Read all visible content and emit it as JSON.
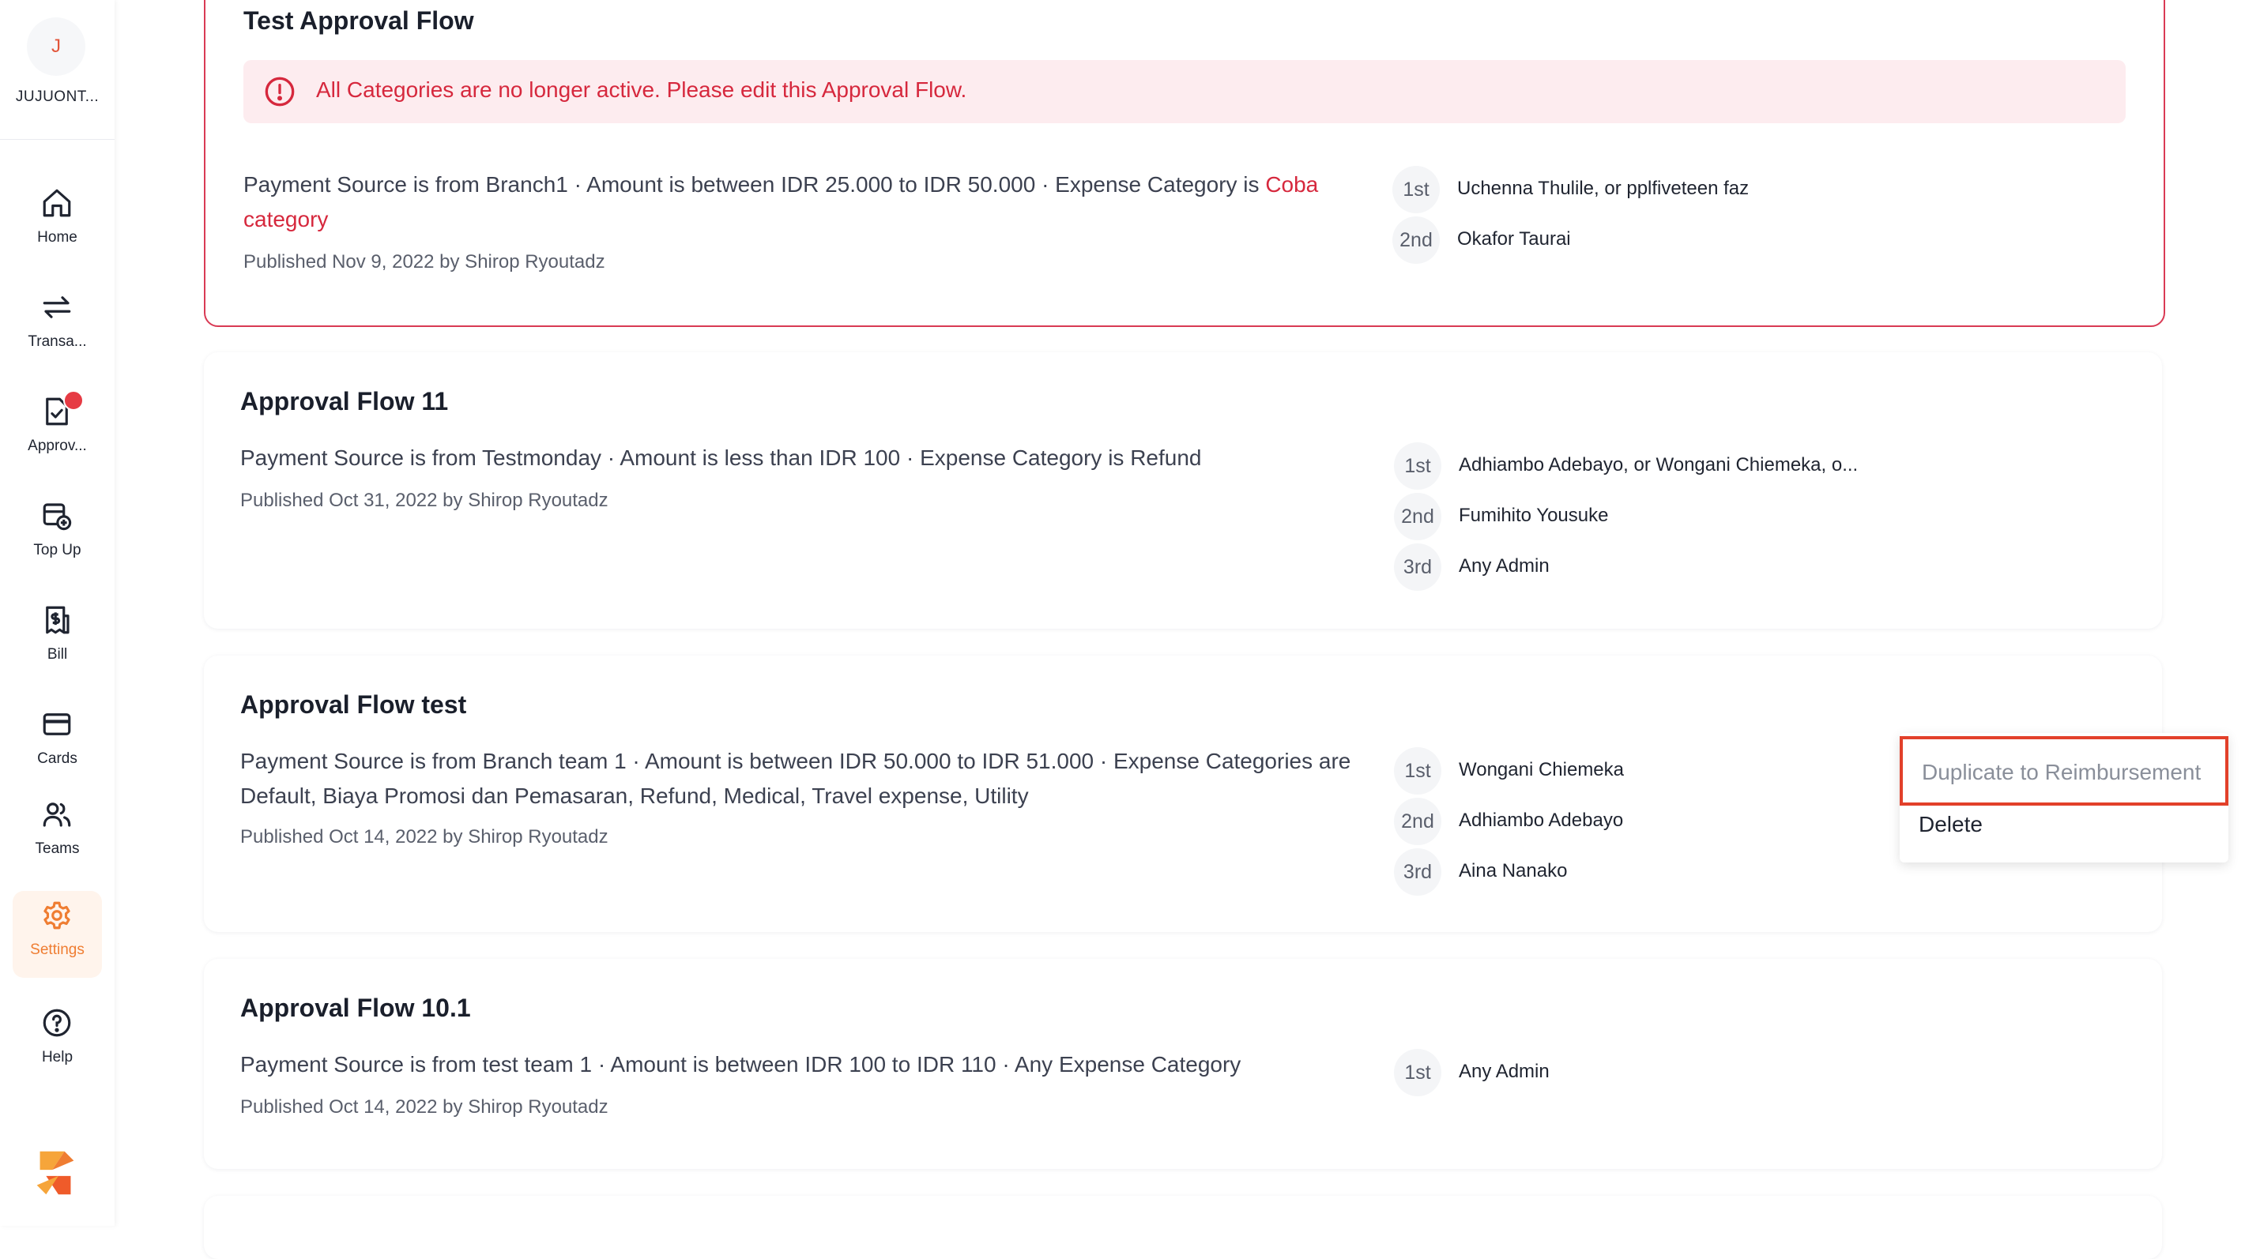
{
  "org": {
    "initial": "J",
    "name": "JUJUONT..."
  },
  "nav": [
    {
      "id": "home",
      "label": "Home",
      "icon": "home-icon"
    },
    {
      "id": "transactions",
      "label": "Transa...",
      "icon": "arrows-swap-icon"
    },
    {
      "id": "approvals",
      "label": "Approv...",
      "icon": "document-check-icon",
      "badge": true
    },
    {
      "id": "topup",
      "label": "Top Up",
      "icon": "wallet-plus-icon"
    },
    {
      "id": "bill",
      "label": "Bill",
      "icon": "bill-icon"
    },
    {
      "id": "cards",
      "label": "Cards",
      "icon": "credit-card-icon"
    },
    {
      "id": "teams",
      "label": "Teams",
      "icon": "users-icon"
    },
    {
      "id": "settings",
      "label": "Settings",
      "icon": "gear-icon",
      "active": true
    },
    {
      "id": "help",
      "label": "Help",
      "icon": "help-circle-icon"
    }
  ],
  "colors": {
    "accent": "#ef7d32",
    "error": "#d6283d",
    "highlight": "#e2402a"
  },
  "flows": [
    {
      "title": "Test Approval Flow",
      "alert": "All Categories are no longer active. Please edit this Approval Flow.",
      "condition_prefix": "Payment Source is from Branch1 · Amount is between IDR 25.000 to IDR 50.000 · Expense Category is ",
      "condition_warn": "Coba category",
      "published": "Published Nov 9, 2022 by Shirop Ryoutadz",
      "steps": [
        {
          "num": "1st",
          "name": "Uchenna Thulile, or pplfiveteen faz"
        },
        {
          "num": "2nd",
          "name": "Okafor Taurai"
        }
      ]
    },
    {
      "title": "Approval Flow 11",
      "condition": "Payment Source is from Testmonday · Amount is less than IDR 100 · Expense Category is Refund",
      "published": "Published Oct 31, 2022 by Shirop Ryoutadz",
      "steps": [
        {
          "num": "1st",
          "name": "Adhiambo Adebayo, or Wongani Chiemeka, o..."
        },
        {
          "num": "2nd",
          "name": "Fumihito Yousuke"
        },
        {
          "num": "3rd",
          "name": "Any Admin"
        }
      ]
    },
    {
      "title": "Approval Flow test",
      "condition": "Payment Source is from Branch team 1 · Amount is between IDR 50.000 to IDR 51.000 · Expense Categories are Default, Biaya Promosi dan Pemasaran, Refund, Medical, Travel expense, Utility",
      "published": "Published Oct 14, 2022 by Shirop Ryoutadz",
      "steps": [
        {
          "num": "1st",
          "name": "Wongani Chiemeka"
        },
        {
          "num": "2nd",
          "name": "Adhiambo Adebayo"
        },
        {
          "num": "3rd",
          "name": "Aina Nanako"
        }
      ]
    },
    {
      "title": "Approval Flow 10.1",
      "condition": "Payment Source is from test team 1 · Amount is between IDR 100 to IDR 110 · Any Expense Category",
      "published": "Published Oct 14, 2022 by Shirop Ryoutadz",
      "steps": [
        {
          "num": "1st",
          "name": "Any Admin"
        }
      ]
    }
  ],
  "menu": {
    "duplicate": "Duplicate to Reimbursement",
    "delete": "Delete"
  }
}
